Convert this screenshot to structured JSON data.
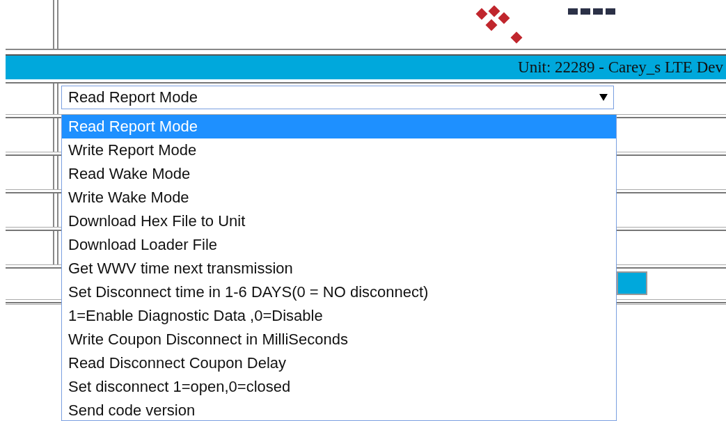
{
  "unit_bar": {
    "title": "Unit: 22289 - Carey_s LTE Dev"
  },
  "command_select": {
    "value": "Read Report Mode",
    "expanded": true,
    "options": [
      {
        "label": "Read Report Mode",
        "selected": true
      },
      {
        "label": "Write Report Mode",
        "selected": false
      },
      {
        "label": "Read Wake Mode",
        "selected": false
      },
      {
        "label": "Write Wake Mode",
        "selected": false
      },
      {
        "label": "Download Hex File to Unit",
        "selected": false
      },
      {
        "label": "Download Loader File",
        "selected": false
      },
      {
        "label": "Get WWV time next transmission",
        "selected": false
      },
      {
        "label": "Set Disconnect time in 1-6 DAYS(0 = NO disconnect)",
        "selected": false
      },
      {
        "label": "1=Enable Diagnostic Data ,0=Disable",
        "selected": false
      },
      {
        "label": "Write Coupon Disconnect in MilliSeconds",
        "selected": false
      },
      {
        "label": "Read Disconnect Coupon Delay",
        "selected": false
      },
      {
        "label": "Set disconnect 1=open,0=closed",
        "selected": false
      },
      {
        "label": "Send code version",
        "selected": false
      }
    ]
  }
}
